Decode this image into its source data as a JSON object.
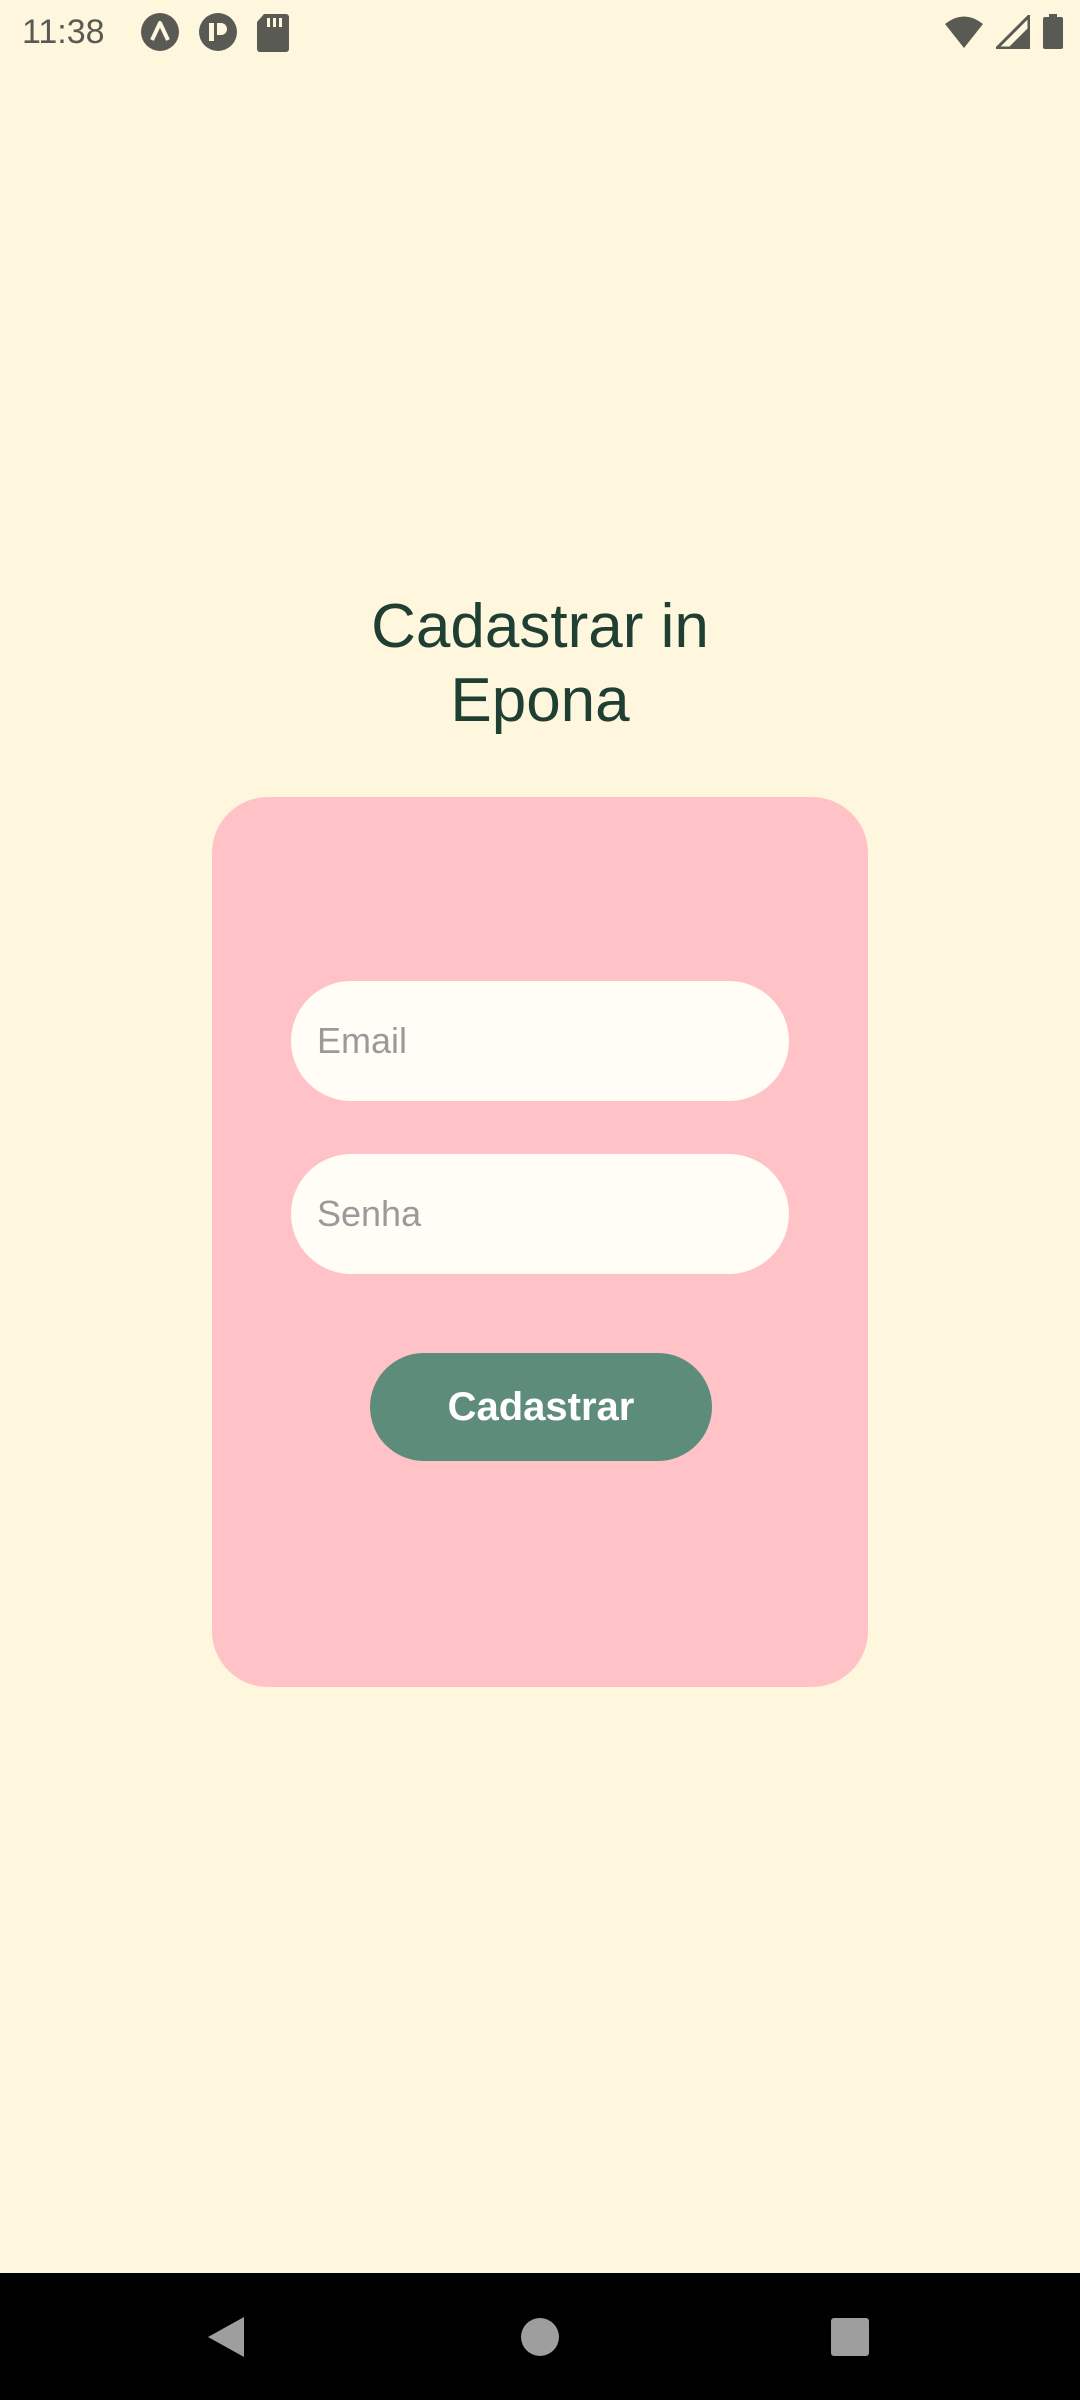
{
  "status_bar": {
    "time": "11:38",
    "left_icons": [
      "app-a-icon",
      "app-p-icon",
      "sd-card-icon"
    ],
    "right_icons": [
      "wifi-icon",
      "signal-icon",
      "battery-icon"
    ]
  },
  "title": {
    "line1": "Cadastrar in",
    "line2": "Epona"
  },
  "form": {
    "email_placeholder": "Email",
    "password_placeholder": "Senha",
    "submit_label": "Cadastrar"
  },
  "nav_bar": {
    "buttons": [
      "back-icon",
      "home-icon",
      "recents-icon"
    ]
  },
  "colors": {
    "background": "#FEF7DE",
    "card": "#FFC2C6",
    "field": "#FFFDF6",
    "button": "#5E8C7A",
    "title": "#1F3F32"
  }
}
